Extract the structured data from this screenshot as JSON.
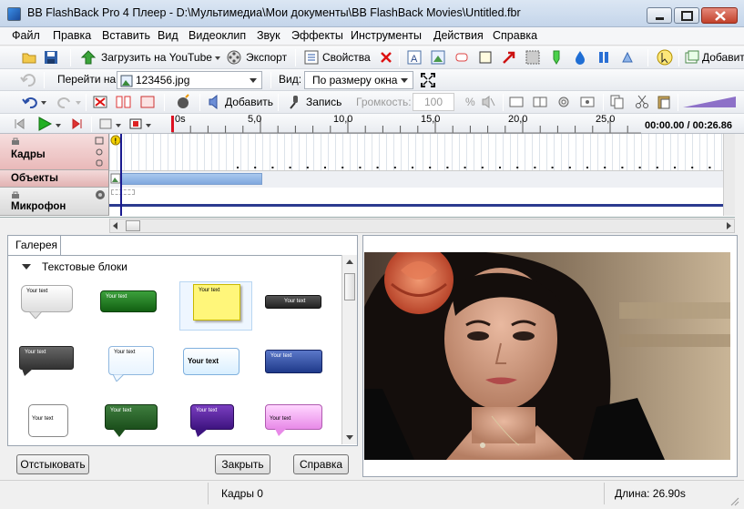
{
  "window": {
    "title": "BB FlashBack Pro 4 Плеер - D:\\Мультимедиа\\Мои документы\\BB FlashBack Movies\\Untitled.fbr"
  },
  "menu": [
    "Файл",
    "Правка",
    "Вставить",
    "Вид",
    "Видеоклип",
    "Звук",
    "Эффекты",
    "Инструменты",
    "Действия",
    "Справка"
  ],
  "toolbar1": {
    "upload_label": "Загрузить на YouTube",
    "export_label": "Экспорт",
    "properties_label": "Свойства",
    "add_label": "Добавить"
  },
  "toolbar2": {
    "goto_label": "Перейти на:",
    "goto_value": "123456.jpg",
    "view_label": "Вид:",
    "view_value": "По размеру окна"
  },
  "toolbar3": {
    "add_label": "Добавить",
    "record_label": "Запись",
    "volume_label": "Громкость:",
    "volume_value": "100",
    "percent": "%"
  },
  "timeline": {
    "ticks": [
      "0s",
      "5,0",
      "10,0",
      "15,0",
      "20,0",
      "25,0"
    ],
    "time_readout": "00:00.00 / 00:26.86",
    "tracks": {
      "frames": "Кадры",
      "objects": "Объекты",
      "mic": "Микрофон"
    }
  },
  "gallery": {
    "tab_label": "Галерея",
    "section_title": "Текстовые блоки",
    "items": [
      {
        "text": "Your text"
      },
      {
        "text": "Your text"
      },
      {
        "text": "Your text"
      },
      {
        "text": "Your text"
      },
      {
        "text": "Your text"
      },
      {
        "text": "Your text"
      },
      {
        "text": "Your text"
      },
      {
        "text": "Your text"
      },
      {
        "text": "Your text"
      },
      {
        "text": "Your text"
      },
      {
        "text": "Your text"
      },
      {
        "text": "Your text"
      }
    ]
  },
  "buttons": {
    "undock": "Отстыковать",
    "close": "Закрыть",
    "help": "Справка"
  },
  "status": {
    "frames": "Кадры 0",
    "length": "Длина: 26.90s"
  }
}
